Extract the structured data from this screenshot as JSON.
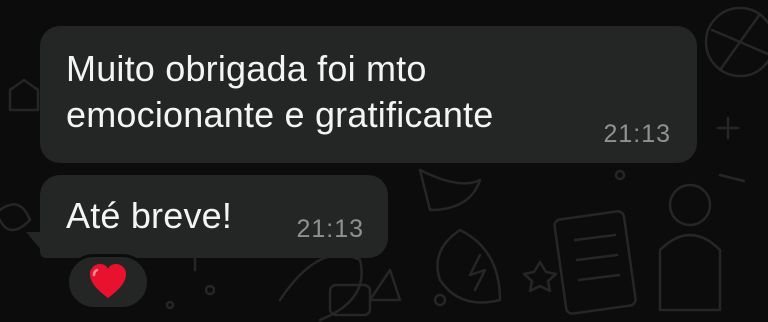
{
  "messages": [
    {
      "line1": "Muito obrigada foi mto",
      "line2": "emocionante e gratificante",
      "time": "21:13"
    },
    {
      "text": "Até breve!",
      "time": "21:13",
      "reaction": "heart-emoji"
    }
  ],
  "colors": {
    "background": "#0c0c0c",
    "bubble": "#242626",
    "text": "#f4f4f4",
    "timestamp": "#8e9192",
    "reaction_heart": "#e8122f"
  }
}
